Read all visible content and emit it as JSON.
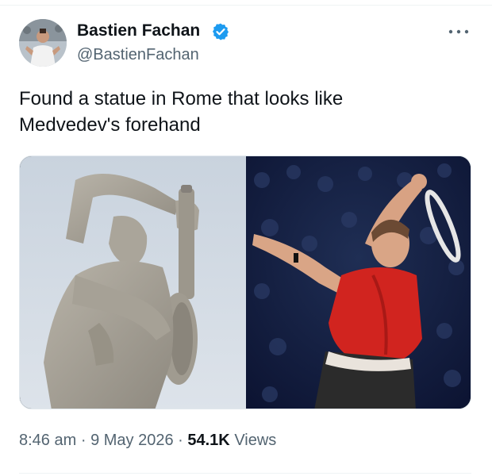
{
  "author": {
    "display_name": "Bastien Fachan",
    "handle": "@BastienFachan",
    "verified": true,
    "verified_color": "#1d9bf0"
  },
  "tweet": {
    "text_line1": "Found a statue in Rome that looks like",
    "text_line2": "Medvedev's forehand"
  },
  "meta": {
    "time": "8:46 am",
    "separator": "·",
    "date": "9 May 2026",
    "views_count": "54.1K",
    "views_label": "Views"
  },
  "icons": {
    "more": "more-horizontal-icon",
    "verified": "verified-badge-icon"
  },
  "colors": {
    "text": "#0f1419",
    "secondary": "#536471",
    "accent": "#1d9bf0"
  }
}
